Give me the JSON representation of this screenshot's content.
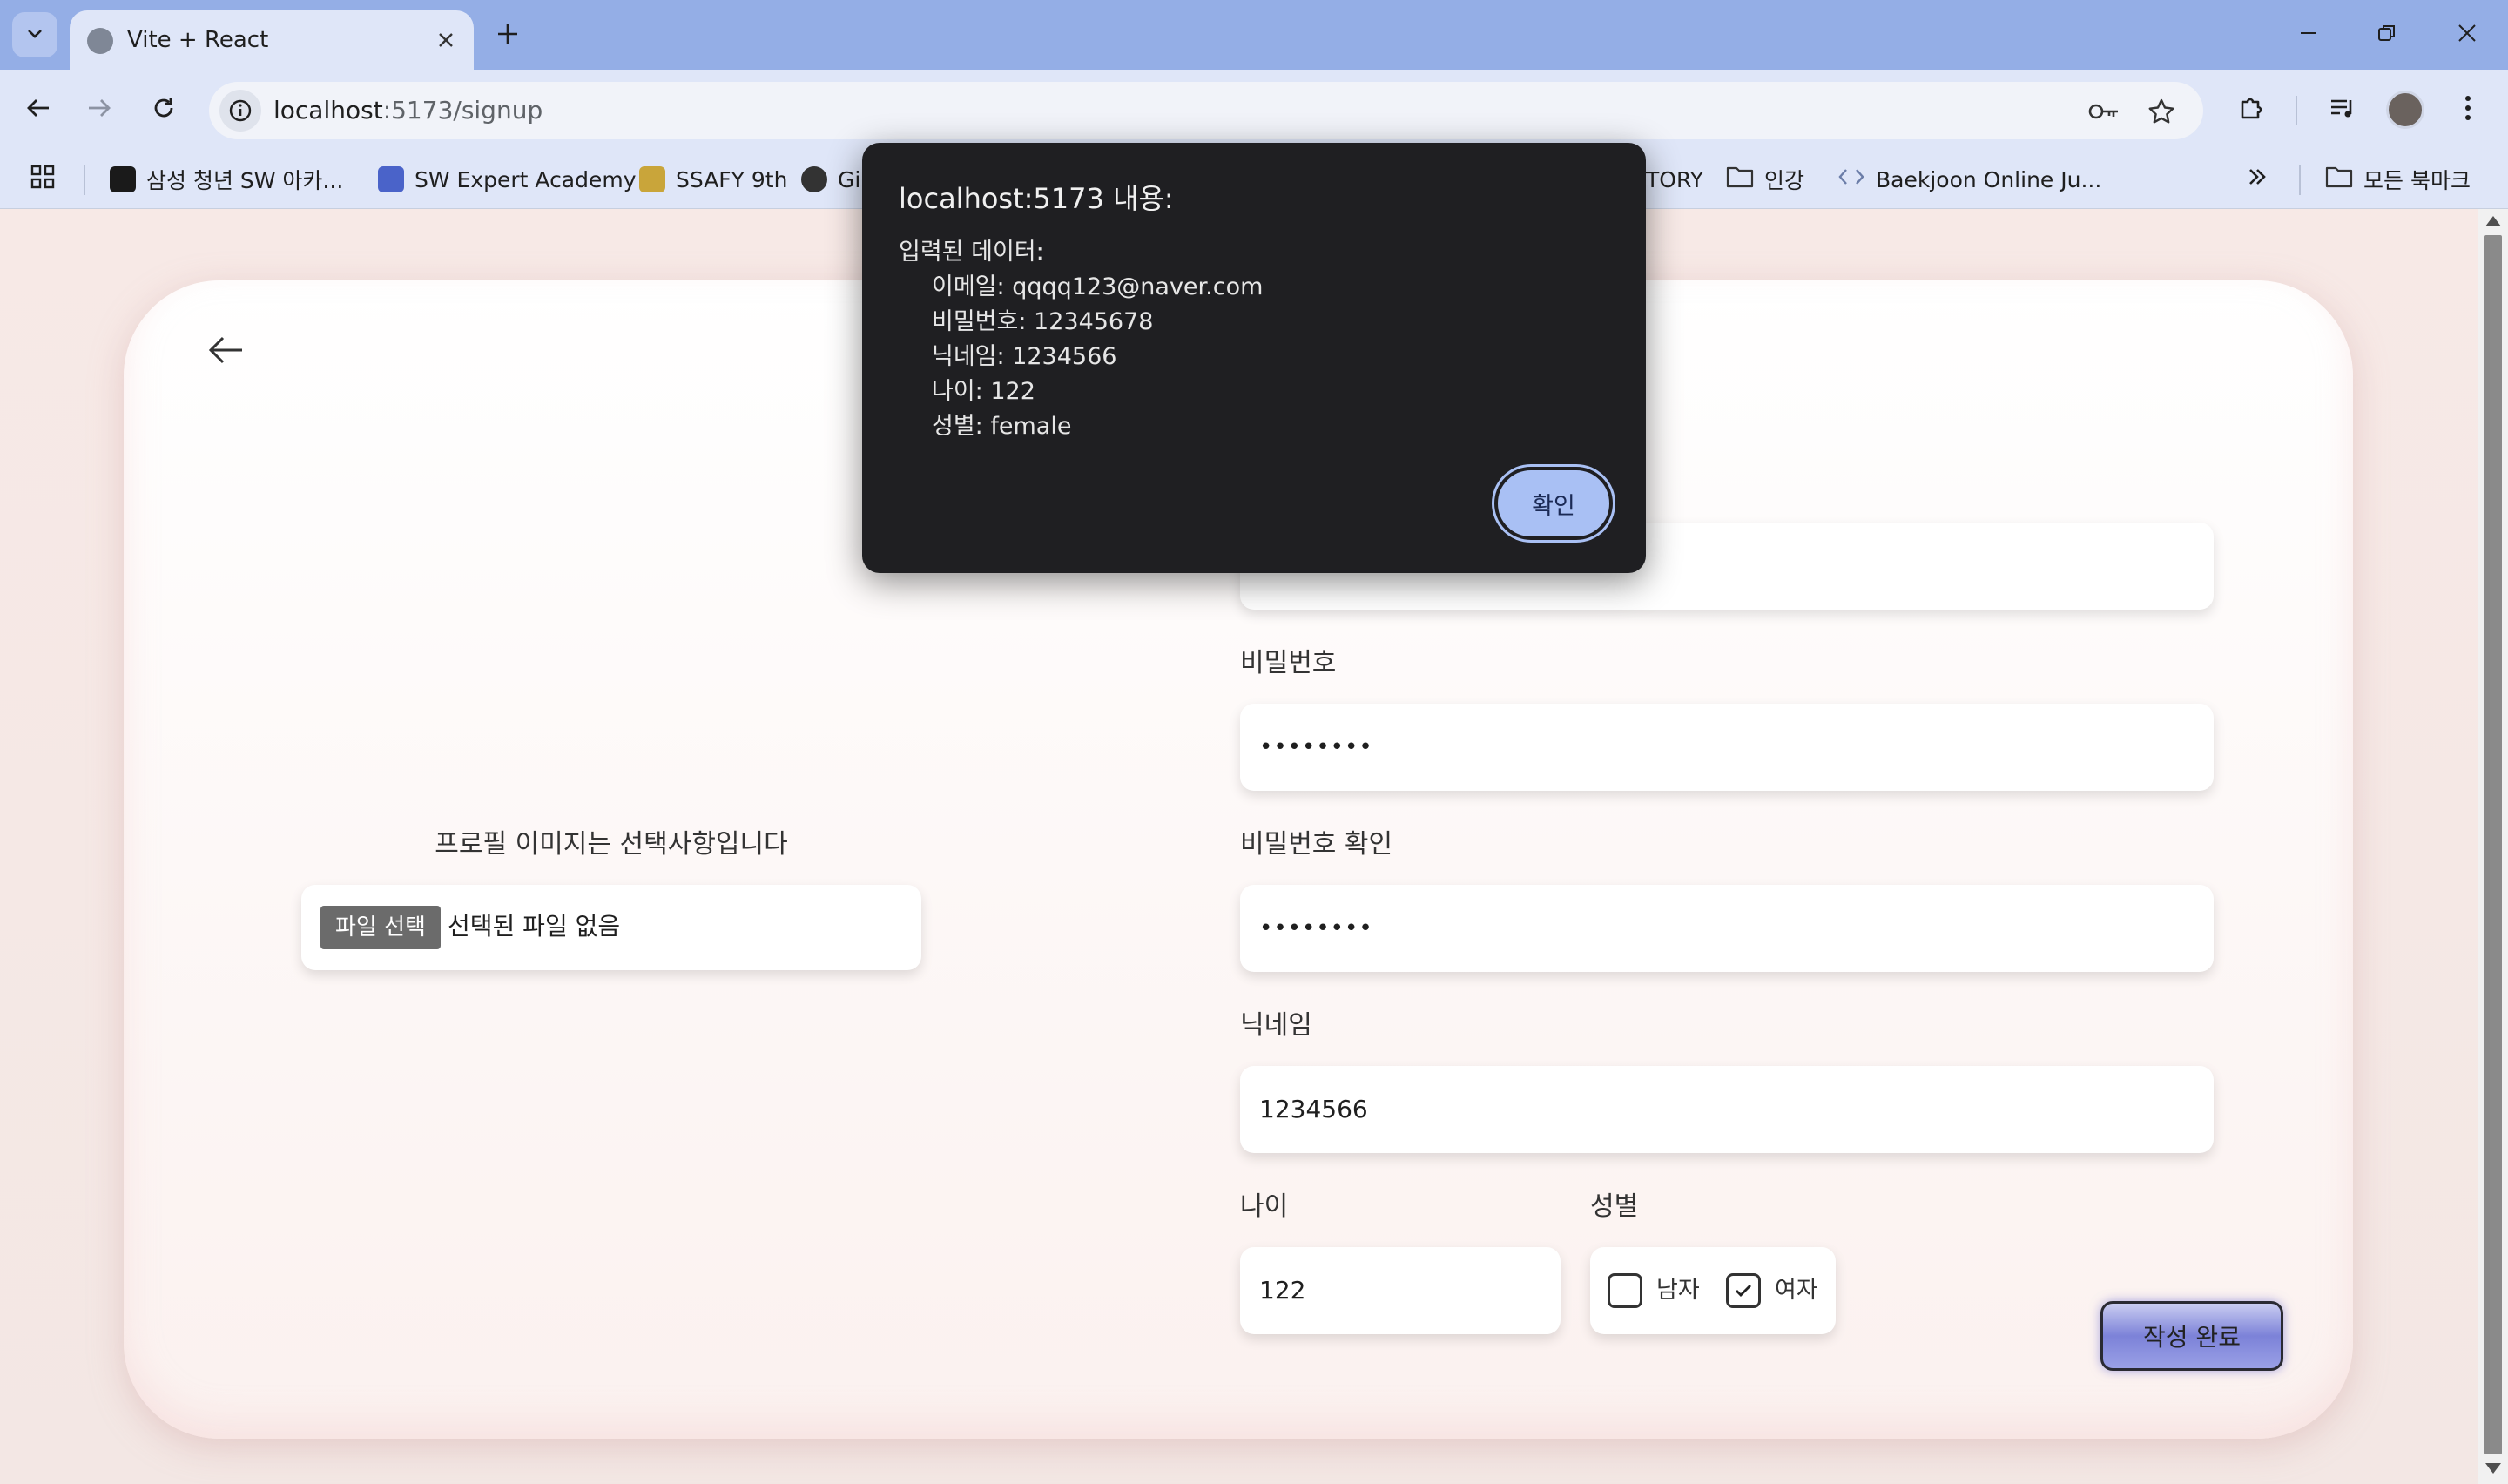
{
  "browser": {
    "tab_title": "Vite + React",
    "url_host": "localhost",
    "url_path": ":5173/signup",
    "bookmarks": [
      {
        "label": "삼성 청년 SW 아카...",
        "color": "#1a1a1a"
      },
      {
        "label": "SW Expert Academy",
        "color": "#4a63c9"
      },
      {
        "label": "SSAFY 9th",
        "color": "#c9a53a"
      },
      {
        "label": "Gi",
        "color": "#333333"
      },
      {
        "label": "TORY",
        "color": ""
      },
      {
        "label": "인강",
        "color": ""
      },
      {
        "label": "Baekjoon Online Ju...",
        "color": ""
      },
      {
        "label": "모든 북마크",
        "color": ""
      }
    ]
  },
  "page": {
    "profile_label": "프로필 이미지는 선택사항입니다",
    "file_button": "파일 선택",
    "file_status": "선택된 파일 없음",
    "password_label": "비밀번호",
    "password_value": "••••••••",
    "password_confirm_label": "비밀번호 확인",
    "password_confirm_value": "••••••••",
    "nickname_label": "닉네임",
    "nickname_value": "1234566",
    "age_label": "나이",
    "age_value": "122",
    "gender_label": "성별",
    "gender_male": "남자",
    "gender_female": "여자",
    "gender_selected": "female",
    "submit_label": "작성 완료"
  },
  "dialog": {
    "title": "localhost:5173 내용:",
    "header": "입력된 데이터:",
    "lines": [
      "이메일: qqqq123@naver.com",
      "비밀번호: 12345678",
      "닉네임: 1234566",
      "나이: 122",
      "성별: female"
    ],
    "ok_label": "확인"
  },
  "colors": {
    "titlebar": "#94aee6",
    "toolbar": "#dfe6f8",
    "dialog_bg": "#1f1f22",
    "dialog_button": "#a9c0f4",
    "submit_accent": "#7c82d8"
  }
}
